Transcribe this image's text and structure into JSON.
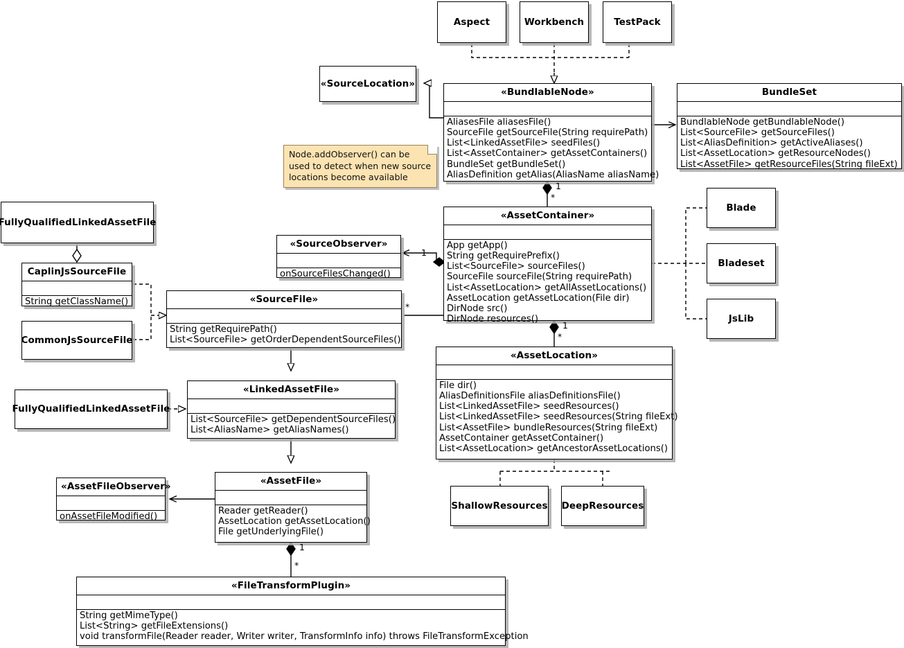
{
  "diagram": {
    "title": "BRJS model UML class diagram",
    "note": {
      "text": "Node.addObserver() can be\nused to detect when new source\nlocations become available"
    },
    "colors": {
      "note_bg": "#fce3b2",
      "note_border": "#9a8357",
      "box_bg": "#ffffff",
      "box_border": "#000000",
      "shadow": "#aaaaaa"
    },
    "classes": {
      "aspect": {
        "name": "Aspect"
      },
      "workbench": {
        "name": "Workbench"
      },
      "testpack": {
        "name": "TestPack"
      },
      "source_location": {
        "name": "«SourceLocation»"
      },
      "bundlable_node": {
        "name": "«BundlableNode»",
        "operations": [
          "AliasesFile aliasesFile()",
          "SourceFile getSourceFile(String requirePath)",
          "List<LinkedAssetFile> seedFiles()",
          "List<AssetContainer> getAssetContainers()",
          "BundleSet getBundleSet()",
          "AliasDefinition getAlias(AliasName aliasName)"
        ]
      },
      "bundle_set": {
        "name": "BundleSet",
        "operations": [
          "BundlableNode getBundlableNode()",
          "List<SourceFile> getSourceFiles()",
          "List<AliasDefinition> getActiveAliases()",
          "List<AssetLocation> getResourceNodes()",
          "List<AssetFile> getResourceFiles(String fileExt)"
        ]
      },
      "asset_container": {
        "name": "«AssetContainer»",
        "operations": [
          "App getApp()",
          "String getRequirePrefix()",
          "List<SourceFile> sourceFiles()",
          "SourceFile sourceFile(String requirePath)",
          "List<AssetLocation> getAllAssetLocations()",
          "AssetLocation getAssetLocation(File dir)",
          "DirNode src()",
          "DirNode resources()"
        ]
      },
      "asset_location": {
        "name": "«AssetLocation»",
        "operations": [
          "File dir()",
          "AliasDefinitionsFile aliasDefinitionsFile()",
          "List<LinkedAssetFile> seedResources()",
          "List<LinkedAssetFile> seedResources(String fileExt)",
          "List<AssetFile> bundleResources(String fileExt)",
          "AssetContainer getAssetContainer()",
          "List<AssetLocation> getAncestorAssetLocations()"
        ]
      },
      "blade": {
        "name": "Blade"
      },
      "bladeset": {
        "name": "Bladeset"
      },
      "jslib": {
        "name": "JsLib"
      },
      "shallow_resources": {
        "name": "ShallowResources"
      },
      "deep_resources": {
        "name": "DeepResources"
      },
      "fqlaf_top": {
        "name": "FullyQualifiedLinkedAssetFile"
      },
      "caplinjs_source_file": {
        "name": "CaplinJsSourceFile",
        "operations": [
          "String getClassName()"
        ]
      },
      "commonjs_source_file": {
        "name": "CommonJsSourceFile"
      },
      "source_observer": {
        "name": "«SourceObserver»",
        "operations": [
          "onSourceFilesChanged()"
        ]
      },
      "source_file": {
        "name": "«SourceFile»",
        "operations": [
          "String getRequirePath()",
          "List<SourceFile> getOrderDependentSourceFiles()"
        ]
      },
      "fqlaf_bottom": {
        "name": "FullyQualifiedLinkedAssetFile"
      },
      "linked_asset_file": {
        "name": "«LinkedAssetFile»",
        "operations": [
          "List<SourceFile> getDependentSourceFiles()",
          "List<AliasName> getAliasNames()"
        ]
      },
      "asset_file_observer": {
        "name": "«AssetFileObserver»",
        "operations": [
          "onAssetFileModified()"
        ]
      },
      "asset_file": {
        "name": "«AssetFile»",
        "operations": [
          "Reader getReader()",
          "AssetLocation getAssetLocation()",
          "File getUnderlyingFile()"
        ]
      },
      "file_transform_plugin": {
        "name": "«FileTransformPlugin»",
        "operations": [
          "String getMimeType()",
          "List<String> getFileExtensions()",
          "void transformFile(Reader reader, Writer writer, TransformInfo info) throws FileTransformException"
        ]
      }
    },
    "multiplicities": {
      "bundlable_to_container_one": "1",
      "bundlable_to_container_many": "*",
      "container_observer_one": "1",
      "container_sourcefile_many": "*",
      "container_to_location_one": "1",
      "container_to_location_many": "*",
      "assetfile_to_plugin_one": "1",
      "assetfile_to_plugin_many": "*"
    }
  }
}
